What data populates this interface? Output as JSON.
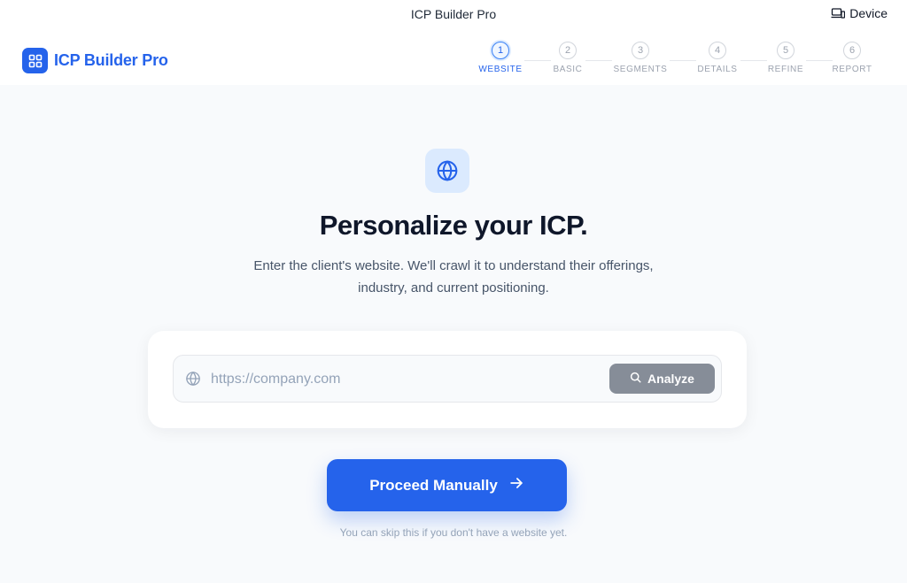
{
  "window": {
    "title": "ICP Builder Pro",
    "device_label": "Device",
    "device_icon": "laptop-phone-icon"
  },
  "brand": {
    "name": "ICP Builder Pro",
    "icon": "grid-icon",
    "color": "#2563eb"
  },
  "stepper": {
    "current_step": 1,
    "steps": [
      {
        "number": "1",
        "label": "WEBSITE"
      },
      {
        "number": "2",
        "label": "BASIC"
      },
      {
        "number": "3",
        "label": "SEGMENTS"
      },
      {
        "number": "4",
        "label": "DETAILS"
      },
      {
        "number": "5",
        "label": "REFINE"
      },
      {
        "number": "6",
        "label": "REPORT"
      }
    ]
  },
  "main": {
    "icon": "globe-icon",
    "headline": "Personalize your ICP.",
    "subtext": "Enter the client's website. We'll crawl it to understand their offerings, industry, and current positioning.",
    "url_input": {
      "placeholder": "https://company.com",
      "value": ""
    },
    "analyze_button": {
      "label": "Analyze",
      "icon": "search-icon"
    },
    "proceed_button": {
      "label": "Proceed Manually",
      "icon": "arrow-right-icon"
    },
    "hint": "You can skip this if you don't have a website yet."
  },
  "colors": {
    "accent": "#2563eb",
    "background": "#f8fafc",
    "analyze_disabled": "#868d98"
  }
}
